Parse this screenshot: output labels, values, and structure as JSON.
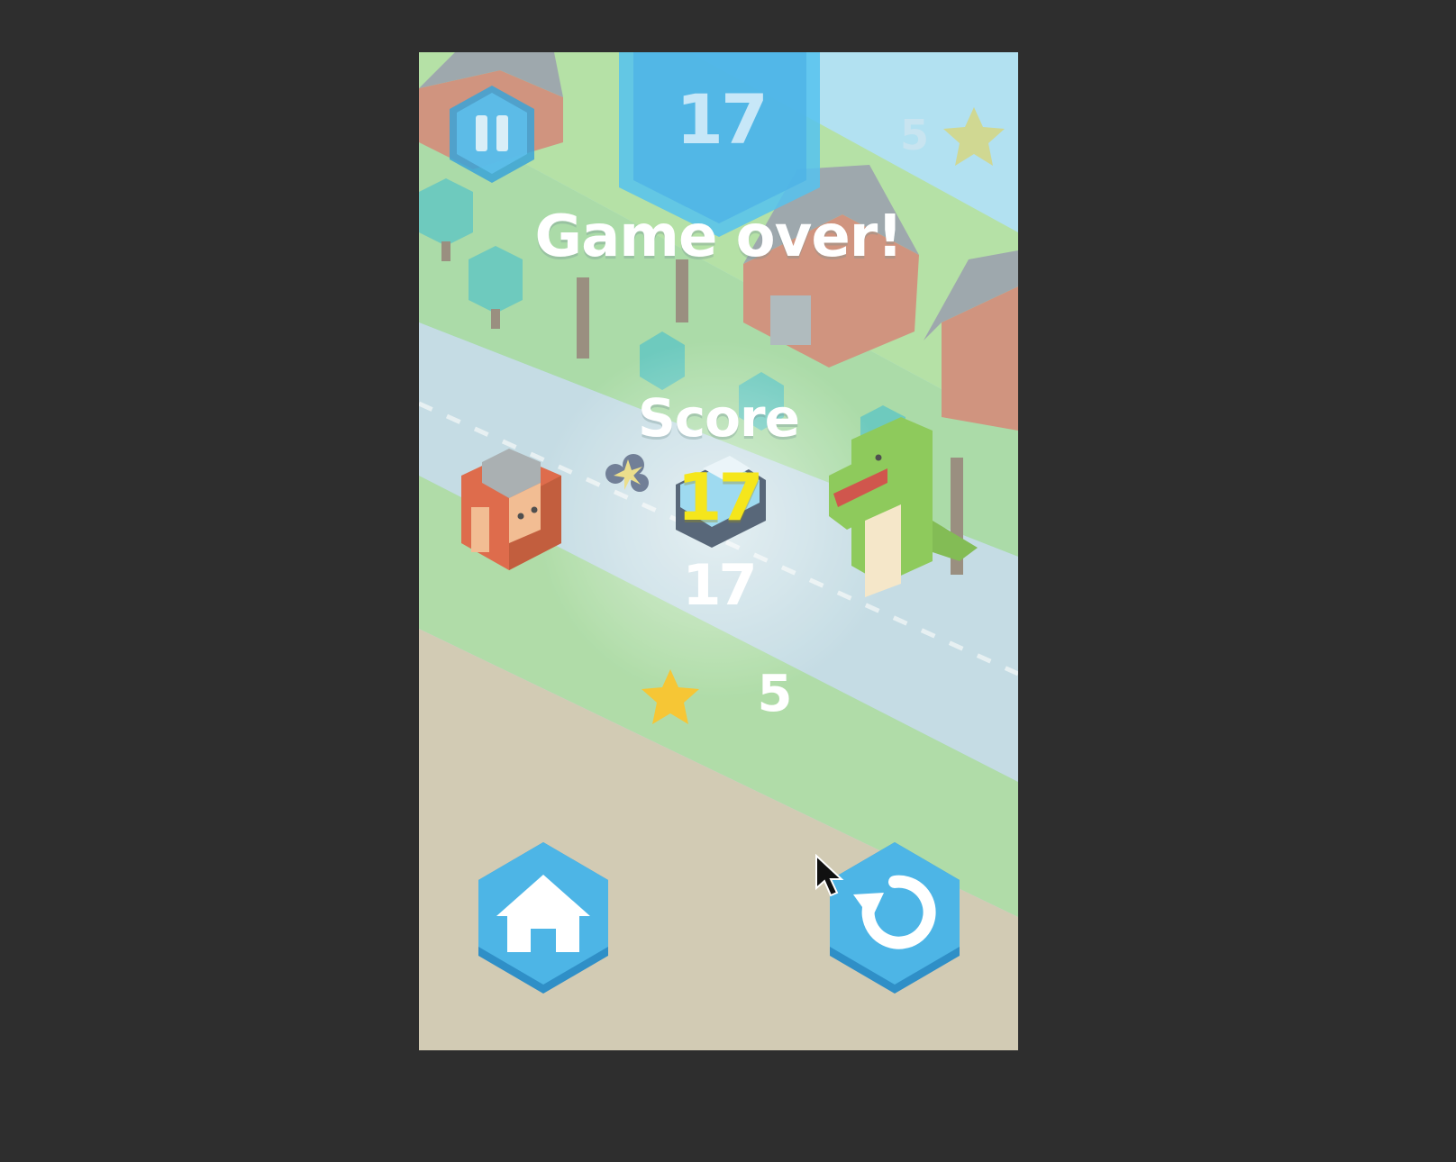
{
  "hud": {
    "score": "17",
    "stars": "5"
  },
  "game_over": {
    "title": "Game over!",
    "score_label": "Score",
    "score": "17",
    "best": "17",
    "stars": "5"
  },
  "colors": {
    "button_blue": "#4db5e6",
    "button_dark": "#2f8fc7",
    "score_yellow": "#f5e61c",
    "star_gold": "#f6c635"
  },
  "icons": [
    "pause-icon",
    "star-icon",
    "home-icon",
    "restart-icon"
  ]
}
